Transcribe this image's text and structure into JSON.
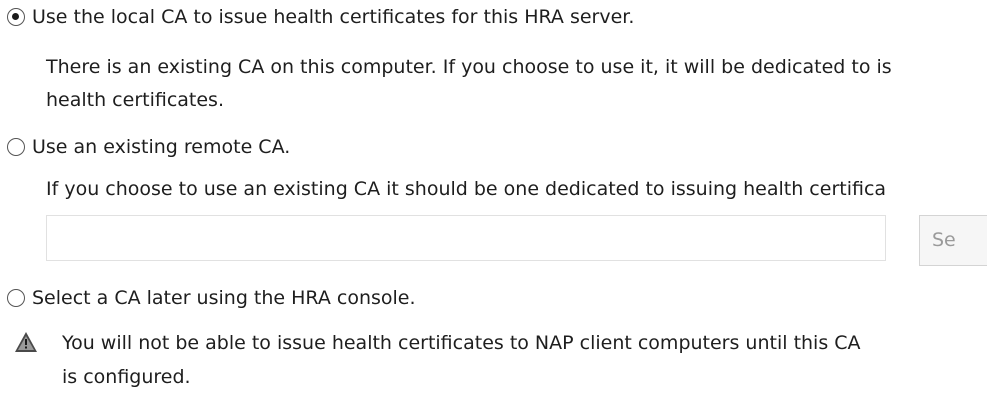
{
  "options": [
    {
      "label": "Use the local CA to issue health certificates for this HRA server.",
      "description": "There is an existing CA on this computer. If you choose to use it, it will be dedicated to is",
      "description_line2": "health certificates.",
      "selected": true
    },
    {
      "label": "Use an existing remote CA.",
      "description": "If you choose to use an existing CA it should be one dedicated to issuing health certifica",
      "input_value": "",
      "button_label": "Se",
      "selected": false
    },
    {
      "label": "Select a CA later using the HRA console.",
      "selected": false
    }
  ],
  "warning": {
    "icon": "warning-triangle-icon",
    "line1": "You will not be able to issue health certificates to NAP client computers until this CA",
    "line2": "is configured."
  }
}
